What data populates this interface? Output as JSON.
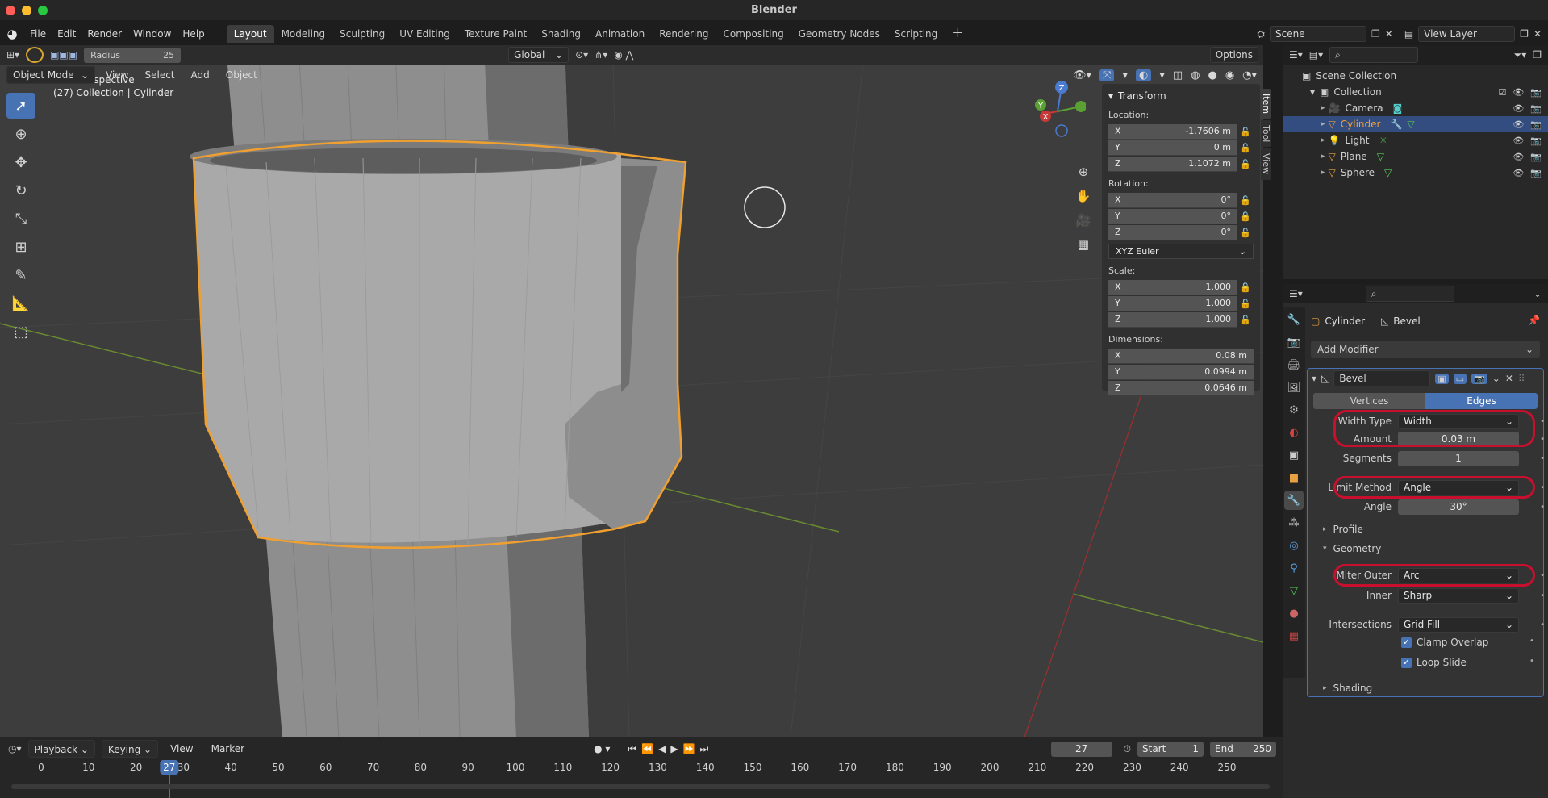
{
  "window": {
    "title": "Blender",
    "traffic_lights": [
      "#ff5f57",
      "#febc2e",
      "#28c840"
    ]
  },
  "menu": [
    "File",
    "Edit",
    "Render",
    "Window",
    "Help"
  ],
  "workspaces": {
    "tabs": [
      "Layout",
      "Modeling",
      "Sculpting",
      "UV Editing",
      "Texture Paint",
      "Shading",
      "Animation",
      "Rendering",
      "Compositing",
      "Geometry Nodes",
      "Scripting"
    ],
    "active": "Layout",
    "add_icon": "plus-icon"
  },
  "scene": {
    "name": "Scene",
    "view_layer": "View Layer"
  },
  "tool_settings": {
    "radius_label": "Radius",
    "radius_value": "25",
    "orientation": "Global",
    "options_label": "Options"
  },
  "viewport_header": {
    "mode": "Object Mode",
    "menus": [
      "View",
      "Select",
      "Add",
      "Object"
    ]
  },
  "viewport": {
    "perspective": "User Perspective",
    "info": "(27) Collection | Cylinder",
    "accent_color": "#f0a030"
  },
  "gizmo": {
    "x": "X",
    "y": "Y",
    "z": "Z"
  },
  "npanel": {
    "section": "Transform",
    "location_label": "Location:",
    "location": [
      {
        "axis": "X",
        "value": "-1.7606 m"
      },
      {
        "axis": "Y",
        "value": "0 m"
      },
      {
        "axis": "Z",
        "value": "1.1072 m"
      }
    ],
    "rotation_label": "Rotation:",
    "rotation": [
      {
        "axis": "X",
        "value": "0°"
      },
      {
        "axis": "Y",
        "value": "0°"
      },
      {
        "axis": "Z",
        "value": "0°"
      }
    ],
    "rotation_mode": "XYZ Euler",
    "scale_label": "Scale:",
    "scale": [
      {
        "axis": "X",
        "value": "1.000"
      },
      {
        "axis": "Y",
        "value": "1.000"
      },
      {
        "axis": "Z",
        "value": "1.000"
      }
    ],
    "dimensions_label": "Dimensions:",
    "dimensions": [
      {
        "axis": "X",
        "value": "0.08 m"
      },
      {
        "axis": "Y",
        "value": "0.0994 m"
      },
      {
        "axis": "Z",
        "value": "0.0646 m"
      }
    ],
    "tabs": [
      "Item",
      "Tool",
      "View"
    ]
  },
  "outliner": {
    "root": "Scene Collection",
    "collection": "Collection",
    "objects": [
      {
        "name": "Camera",
        "icon": "camera-icon",
        "selected": false
      },
      {
        "name": "Cylinder",
        "icon": "mesh-icon",
        "selected": true
      },
      {
        "name": "Light",
        "icon": "light-icon",
        "selected": false
      },
      {
        "name": "Plane",
        "icon": "mesh-icon",
        "selected": false
      },
      {
        "name": "Sphere",
        "icon": "mesh-icon",
        "selected": false
      }
    ]
  },
  "properties": {
    "object": "Cylinder",
    "modifier_context": "Bevel",
    "add_modifier": "Add Modifier",
    "modifier_name": "Bevel",
    "mode_tabs": [
      "Vertices",
      "Edges"
    ],
    "active_mode": "Edges",
    "fields": {
      "width_type": {
        "label": "Width Type",
        "value": "Width"
      },
      "amount": {
        "label": "Amount",
        "value": "0.03 m"
      },
      "segments": {
        "label": "Segments",
        "value": "1"
      },
      "limit_method": {
        "label": "Limit Method",
        "value": "Angle"
      },
      "angle": {
        "label": "Angle",
        "value": "30°"
      },
      "miter_outer": {
        "label": "Miter Outer",
        "value": "Arc"
      },
      "inner": {
        "label": "Inner",
        "value": "Sharp"
      },
      "intersections": {
        "label": "Intersections",
        "value": "Grid Fill"
      }
    },
    "profile": "Profile",
    "geometry": "Geometry",
    "clamp_overlap": "Clamp Overlap",
    "loop_slide": "Loop Slide",
    "shading": "Shading",
    "highlight_color": "#c8102e"
  },
  "timeline": {
    "menus": [
      "Playback",
      "Keying",
      "View",
      "Marker"
    ],
    "current_frame": "27",
    "start_label": "Start",
    "start": "1",
    "end_label": "End",
    "end": "250",
    "ticks": [
      "0",
      "10",
      "20",
      "30",
      "40",
      "50",
      "60",
      "70",
      "80",
      "90",
      "100",
      "110",
      "120",
      "130",
      "140",
      "150",
      "160",
      "170",
      "180",
      "190",
      "200",
      "210",
      "220",
      "230",
      "240",
      "250"
    ],
    "playhead_color": "#4772b3"
  }
}
